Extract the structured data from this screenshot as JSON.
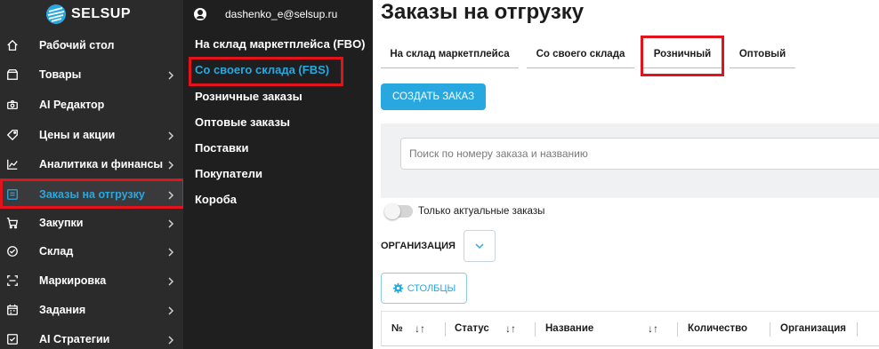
{
  "logo": {
    "text": "SELSUP"
  },
  "sidebar": {
    "items": [
      {
        "label": "Рабочий стол",
        "icon": "home-icon",
        "chevron": false
      },
      {
        "label": "Товары",
        "icon": "box-icon",
        "chevron": true
      },
      {
        "label": "AI Редактор",
        "icon": "camera-icon",
        "chevron": false
      },
      {
        "label": "Цены и акции",
        "icon": "tag-icon",
        "chevron": true
      },
      {
        "label": "Аналитика и финансы",
        "icon": "chart-line-icon",
        "chevron": true
      },
      {
        "label": "Заказы на отгрузку",
        "icon": "orders-icon",
        "chevron": true,
        "active": true
      },
      {
        "label": "Закупки",
        "icon": "cart-icon",
        "chevron": true
      },
      {
        "label": "Склад",
        "icon": "check-circle-icon",
        "chevron": true
      },
      {
        "label": "Маркировка",
        "icon": "scan-icon",
        "chevron": true
      },
      {
        "label": "Задания",
        "icon": "calendar-icon",
        "chevron": true
      },
      {
        "label": "AI Стратегии",
        "icon": "checklist-icon",
        "chevron": true
      }
    ]
  },
  "submenu": {
    "user_email": "dashenko_e@selsup.ru",
    "items": [
      {
        "label": "На склад маркетплейса (FBO)"
      },
      {
        "label": "Со своего склада (FBS)",
        "active": true
      },
      {
        "label": "Розничные заказы"
      },
      {
        "label": "Оптовые заказы"
      },
      {
        "label": "Поставки"
      },
      {
        "label": "Покупатели"
      },
      {
        "label": "Короба"
      }
    ]
  },
  "main": {
    "title": "Заказы на отгрузку",
    "tabs": [
      {
        "label": "На склад маркетплейса"
      },
      {
        "label": "Со своего склада"
      },
      {
        "label": "Розничный",
        "selected": true
      },
      {
        "label": "Оптовый"
      }
    ],
    "create_button": "СОЗДАТЬ ЗАКАЗ",
    "search_placeholder": "Поиск по номеру заказа и названию",
    "toggle_label": "Только актуальные заказы",
    "toggle_on": false,
    "org_label": "ОРГАНИЗАЦИЯ",
    "columns_button": "СТОЛБЦЫ",
    "table_headers": [
      "№",
      "Статус",
      "Название",
      "Количество",
      "Организация"
    ],
    "sort_glyph": "↓↑"
  },
  "colors": {
    "sidebar_bg": "#2b2b2c",
    "submenu_bg": "#1f1f20",
    "accent": "#29a8e0",
    "highlight": "#e0141a"
  }
}
